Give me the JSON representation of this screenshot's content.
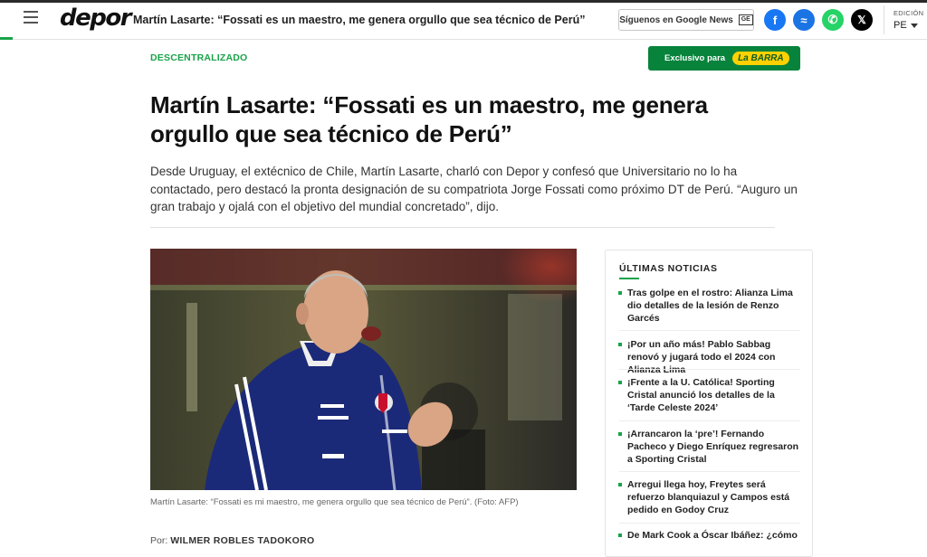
{
  "header": {
    "logo": "depor",
    "article_title": "Martín Lasarte: “Fossati es un maestro, me genera orgullo que sea técnico de Perú”",
    "google_news_label": "Síguenos en Google News",
    "google_news_icon": "GE",
    "social": [
      {
        "name": "facebook-icon",
        "glyph": "f"
      },
      {
        "name": "messenger-icon",
        "glyph": "≈"
      },
      {
        "name": "whatsapp-icon",
        "glyph": "✆"
      },
      {
        "name": "x-icon",
        "glyph": "𝕏"
      }
    ],
    "edition_label": "EDICIÓN",
    "edition_value": "PE"
  },
  "article": {
    "section": "DESCENTRALIZADO",
    "exclusive_label": "Exclusivo para",
    "exclusive_brand": "La BARRA",
    "title": "Martín Lasarte: “Fossati es un maestro, me genera orgullo que sea técnico de Perú”",
    "subtitle": "Desde Uruguay, el extécnico de Chile, Martín Lasarte, charló con Depor y confesó que Universitario no lo ha contactado, pero destacó la pronta designación de su compatriota Jorge Fossati como próximo DT de Perú. “Auguro un gran trabajo y ojalá con el objetivo del mundial concretado”, dijo.",
    "caption": "Martín Lasarte: “Fossati es mi maestro, me genera orgullo que sea técnico de Perú”. (Foto: AFP)",
    "byline_prefix": "Por:",
    "author": "WILMER ROBLES TADOKORO"
  },
  "latest_news": {
    "title": "ÚLTIMAS NOTICIAS",
    "items": [
      {
        "text": "Tras golpe en el rostro: Alianza Lima dio detalles de la lesión de Renzo Garcés"
      },
      {
        "text": "¡Por un año más! Pablo Sabbag renovó y jugará todo el 2024 con Alianza Lima"
      },
      {
        "text": "¡Frente a la U. Católica! Sporting Cristal anunció los detalles de la ‘Tarde Celeste 2024’"
      },
      {
        "text": "¡Arrancaron la ‘pre’! Fernando Pacheco y Diego Enríquez regresaron a Sporting Cristal"
      },
      {
        "text": "Arregui llega hoy, Freytes será refuerzo blanquiazul y Campos está pedido en Godoy Cruz"
      },
      {
        "text": "De Mark Cook a Óscar Ibáñez: ¿cómo"
      }
    ]
  },
  "colors": {
    "accent": "#1aa34a",
    "exclusive_bg": "#07833c",
    "jacket": "#1b2a78"
  }
}
